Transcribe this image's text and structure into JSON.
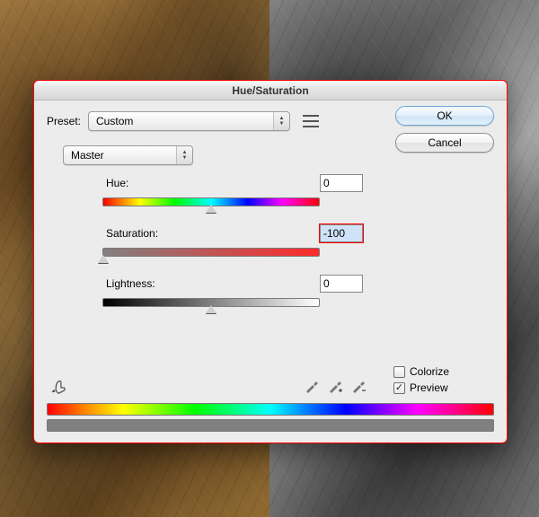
{
  "title": "Hue/Saturation",
  "preset": {
    "label": "Preset:",
    "value": "Custom"
  },
  "buttons": {
    "ok": "OK",
    "cancel": "Cancel"
  },
  "edit": {
    "value": "Master"
  },
  "sliders": {
    "hue": {
      "label": "Hue:",
      "value": "0",
      "pos": 50
    },
    "saturation": {
      "label": "Saturation:",
      "value": "-100",
      "pos": 0
    },
    "lightness": {
      "label": "Lightness:",
      "value": "0",
      "pos": 50
    }
  },
  "checks": {
    "colorize": {
      "label": "Colorize",
      "checked": false
    },
    "preview": {
      "label": "Preview",
      "checked": true
    }
  },
  "icons": {
    "finger": "targeted-adjustment-tool",
    "preset_menu": "preset-menu-icon",
    "eyedropper": "eyedropper-icon",
    "eyedropper_plus": "eyedropper-plus-icon",
    "eyedropper_minus": "eyedropper-minus-icon"
  }
}
